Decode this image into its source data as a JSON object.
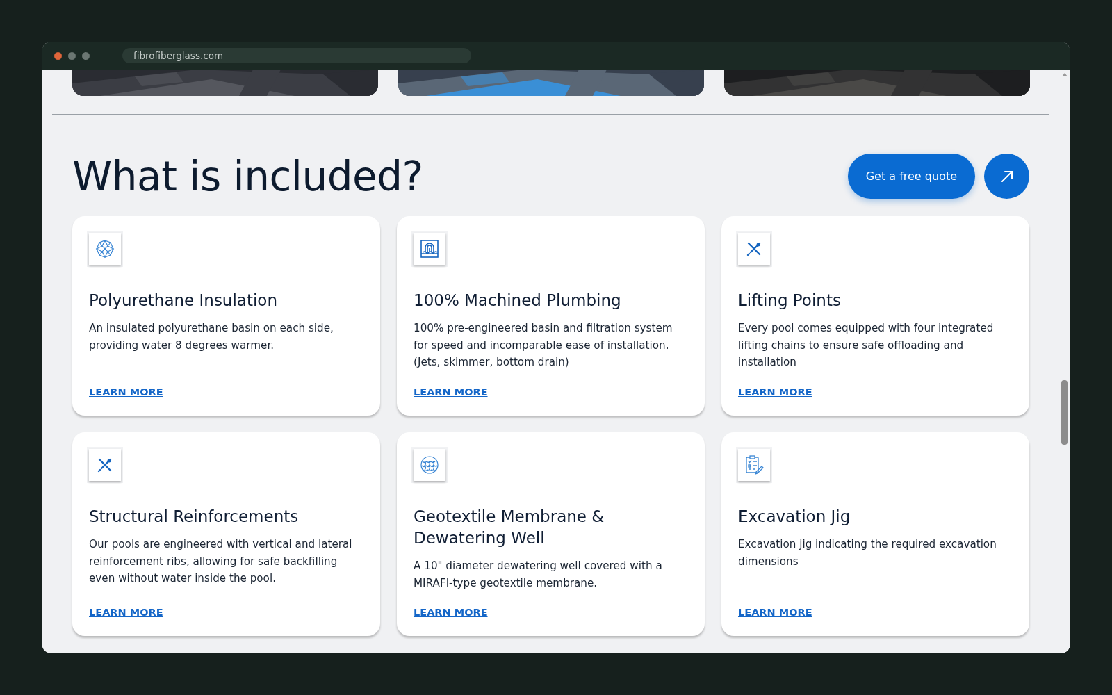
{
  "browser": {
    "url": "fibrofiberglass.com"
  },
  "section": {
    "heading": "What is included?",
    "quote_button": "Get a free quote"
  },
  "cards": [
    {
      "title": "Polyurethane Insulation",
      "text": "An insulated polyurethane basin on each side, providing water 8 degrees warmer.",
      "link": "LEARN MORE"
    },
    {
      "title": "100% Machined Plumbing",
      "text": "100% pre-engineered basin and filtration system for speed and incomparable ease of installation. (Jets, skimmer, bottom drain)",
      "link": "LEARN MORE"
    },
    {
      "title": "Lifting Points",
      "text": "Every pool comes equipped with four integrated lifting chains to ensure safe offloading and installation",
      "link": "LEARN MORE"
    },
    {
      "title": "Structural Reinforcements",
      "text": "Our pools are engineered with vertical and lateral reinforcement ribs, allowing for safe backfilling even without water inside the pool.",
      "link": "LEARN MORE"
    },
    {
      "title": "Geotextile Membrane & Dewatering Well",
      "text": "A 10\" diameter dewatering well covered with a MIRAFI-type geotextile membrane.",
      "link": "LEARN MORE"
    },
    {
      "title": "Excavation Jig",
      "text": "Excavation jig indicating the required excavation dimensions",
      "link": "LEARN MORE"
    }
  ]
}
